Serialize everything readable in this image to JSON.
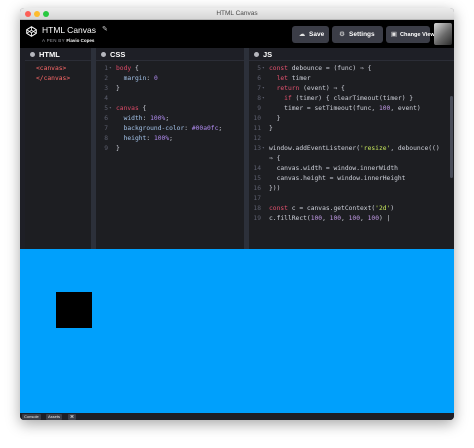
{
  "window": {
    "title": "HTML Canvas"
  },
  "header": {
    "pen_title": "HTML Canvas",
    "byline_prefix": "A PEN BY",
    "author": "Flavio Copes",
    "buttons": {
      "save": "Save",
      "settings": "Settings",
      "change_view": "Change View"
    },
    "icons": {
      "logo": "codepen-logo-icon",
      "edit": "pencil-icon",
      "save": "cloud-icon",
      "settings": "gear-icon",
      "change_view": "layout-icon"
    }
  },
  "panels": {
    "html": {
      "title": "HTML",
      "lines": [
        [
          {
            "t": "<canvas>",
            "c": "tag"
          }
        ],
        [
          {
            "t": "</canvas>",
            "c": "tag"
          }
        ]
      ]
    },
    "css": {
      "title": "CSS",
      "lines": [
        {
          "n": "1",
          "fold": true,
          "tokens": [
            {
              "t": "body",
              "c": "sel"
            },
            {
              "t": " {",
              "c": "pun"
            }
          ]
        },
        {
          "n": "2",
          "tokens": [
            {
              "t": "  margin",
              "c": "prop"
            },
            {
              "t": ": ",
              "c": "pun"
            },
            {
              "t": "0",
              "c": "val"
            }
          ]
        },
        {
          "n": "3",
          "tokens": [
            {
              "t": "}",
              "c": "pun"
            }
          ]
        },
        {
          "n": "4",
          "tokens": []
        },
        {
          "n": "5",
          "fold": true,
          "tokens": [
            {
              "t": "canvas",
              "c": "sel"
            },
            {
              "t": " {",
              "c": "pun"
            }
          ]
        },
        {
          "n": "6",
          "tokens": [
            {
              "t": "  width",
              "c": "prop"
            },
            {
              "t": ": ",
              "c": "pun"
            },
            {
              "t": "100%",
              "c": "val"
            },
            {
              "t": ";",
              "c": "pun"
            }
          ]
        },
        {
          "n": "7",
          "tokens": [
            {
              "t": "  background-color",
              "c": "prop"
            },
            {
              "t": ": ",
              "c": "pun"
            },
            {
              "t": "#00a0fc",
              "c": "val"
            },
            {
              "t": ";",
              "c": "pun"
            }
          ]
        },
        {
          "n": "8",
          "tokens": [
            {
              "t": "  height",
              "c": "prop"
            },
            {
              "t": ": ",
              "c": "pun"
            },
            {
              "t": "100%",
              "c": "val"
            },
            {
              "t": ";",
              "c": "pun"
            }
          ]
        },
        {
          "n": "9",
          "tokens": [
            {
              "t": "}",
              "c": "pun"
            }
          ]
        }
      ]
    },
    "js": {
      "title": "JS",
      "lines": [
        {
          "n": "5",
          "fold": true,
          "tokens": [
            {
              "t": "const",
              "c": "key"
            },
            {
              "t": " debounce = (func) ⇒ {",
              "c": "pun"
            }
          ]
        },
        {
          "n": "6",
          "tokens": [
            {
              "t": "  let",
              "c": "key"
            },
            {
              "t": " timer",
              "c": "pun"
            }
          ]
        },
        {
          "n": "7",
          "fold": true,
          "tokens": [
            {
              "t": "  return",
              "c": "key"
            },
            {
              "t": " (event) ⇒ {",
              "c": "pun"
            }
          ]
        },
        {
          "n": "8",
          "fold": true,
          "tokens": [
            {
              "t": "    if",
              "c": "key"
            },
            {
              "t": " (timer) { clearTimeout(timer) }",
              "c": "pun"
            }
          ]
        },
        {
          "n": "9",
          "tokens": [
            {
              "t": "    timer = setTimeout(func, ",
              "c": "pun"
            },
            {
              "t": "100",
              "c": "num"
            },
            {
              "t": ", event)",
              "c": "pun"
            }
          ]
        },
        {
          "n": "10",
          "tokens": [
            {
              "t": "  }",
              "c": "pun"
            }
          ]
        },
        {
          "n": "11",
          "tokens": [
            {
              "t": "}",
              "c": "pun"
            }
          ]
        },
        {
          "n": "12",
          "tokens": []
        },
        {
          "n": "13",
          "fold": true,
          "tokens": [
            {
              "t": "window.addEventListener(",
              "c": "pun"
            },
            {
              "t": "'resize'",
              "c": "str"
            },
            {
              "t": ", debounce(()",
              "c": "pun"
            }
          ]
        },
        {
          "n": "",
          "tokens": [
            {
              "t": "⇒ {",
              "c": "pun"
            }
          ]
        },
        {
          "n": "14",
          "tokens": [
            {
              "t": "  canvas.width = window.innerWidth",
              "c": "pun"
            }
          ]
        },
        {
          "n": "15",
          "tokens": [
            {
              "t": "  canvas.height = window.innerHeight",
              "c": "pun"
            }
          ]
        },
        {
          "n": "16",
          "tokens": [
            {
              "t": "}))",
              "c": "pun"
            }
          ]
        },
        {
          "n": "17",
          "tokens": []
        },
        {
          "n": "18",
          "tokens": [
            {
              "t": "const",
              "c": "key"
            },
            {
              "t": " c = canvas.getContext(",
              "c": "pun"
            },
            {
              "t": "'2d'",
              "c": "str"
            },
            {
              "t": ")",
              "c": "pun"
            }
          ]
        },
        {
          "n": "19",
          "tokens": [
            {
              "t": "c.fillRect(",
              "c": "pun"
            },
            {
              "t": "100",
              "c": "num"
            },
            {
              "t": ", ",
              "c": "pun"
            },
            {
              "t": "100",
              "c": "num"
            },
            {
              "t": ", ",
              "c": "pun"
            },
            {
              "t": "100",
              "c": "num"
            },
            {
              "t": ", ",
              "c": "pun"
            },
            {
              "t": "100",
              "c": "num"
            },
            {
              "t": ") |",
              "c": "pun"
            }
          ]
        }
      ]
    }
  },
  "preview": {
    "background": "#00a0fc",
    "square_color": "#000000"
  },
  "console": {
    "console_label": "Console",
    "assets_label": "Assets",
    "shortcuts_label": "⌘"
  },
  "colors": {
    "accent_blue": "#00a0fc",
    "tag": "#ff6a6a",
    "selector": "#dd4a68",
    "property": "#a4c3e9",
    "keyword": "#e3526f",
    "string": "#c9ea5e",
    "number": "#c29be6"
  }
}
